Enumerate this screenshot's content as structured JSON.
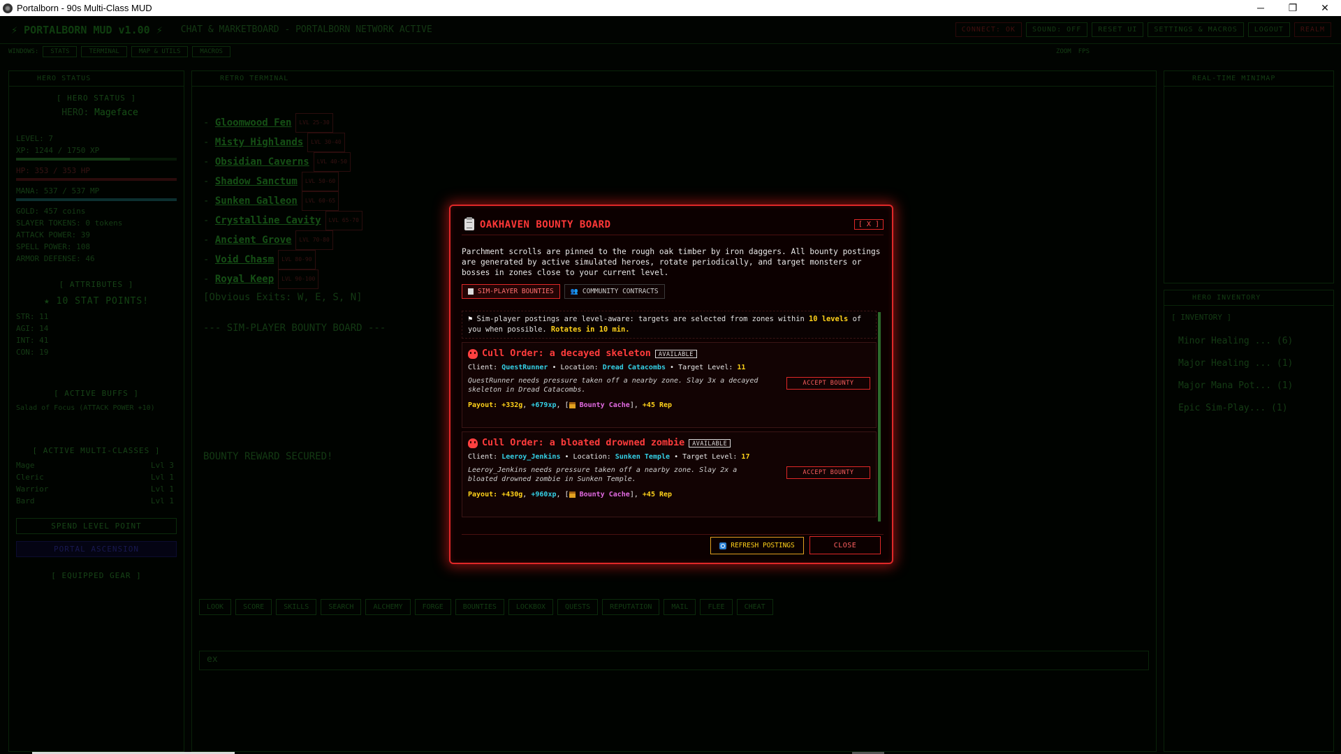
{
  "window": {
    "title": "Portalborn - 90s Multi-Class MUD",
    "minimize": "─",
    "restore": "❐",
    "close": "✕"
  },
  "app": {
    "title": "⚡ PORTALBORN MUD v1.00 ⚡",
    "chat_title": "CHAT & MARKETBOARD - PORTALBORN NETWORK ACTIVE",
    "top_buttons": [
      "CONNECT: OK",
      "SOUND: OFF",
      "RESET UI",
      "SETTINGS & MACROS",
      "LOGOUT",
      "REALM"
    ],
    "windows_label": "WINDOWS:",
    "window_buttons": [
      "STATS",
      "TERMINAL",
      "MAP & UTILS",
      "MACROS"
    ],
    "zoom_label": "ZOOM",
    "fps_label": "FPS"
  },
  "left_panel": {
    "head": "HERO STATUS",
    "hero_status_title": "[ HERO STATUS ]",
    "hero_label": "HERO:",
    "hero_name": "Mageface",
    "level": "LEVEL: 7",
    "xp": "XP: 1244 / 1750 XP",
    "xp_fraction": 0.71,
    "hp": "HP: 353 / 353 HP",
    "hp_fraction": 1.0,
    "mana": "MANA: 537 / 537 MP",
    "mana_fraction": 1.0,
    "gold": "GOLD: 457 coins",
    "slayer": "SLAYER TOKENS: 0 tokens",
    "attack": "ATTACK POWER: 39",
    "spell": "SPELL POWER: 108",
    "armor": "ARMOR DEFENSE: 46",
    "attributes_title": "[ ATTRIBUTES ]",
    "stat_points": "★ 10 STAT POINTS!",
    "attributes": [
      "STR: 11",
      "AGI: 14",
      "INT: 41",
      "CON: 19"
    ],
    "active_buffs_title": "[ ACTIVE BUFFS ]",
    "buff": "Salad of Focus (ATTACK POWER +10)",
    "multi_classes_title": "[ ACTIVE MULTI-CLASSES ]",
    "classes": [
      {
        "name": "Mage",
        "lvl": "Lvl 3"
      },
      {
        "name": "Cleric",
        "lvl": "Lvl 1"
      },
      {
        "name": "Warrior",
        "lvl": "Lvl 1"
      },
      {
        "name": "Bard",
        "lvl": "Lvl 1"
      }
    ],
    "spend_level": "SPEND LEVEL POINT",
    "portal_ascension": "PORTAL ASCENSION",
    "equipped_title": "[ EQUIPPED GEAR ]"
  },
  "terminal": {
    "head": "RETRO TERMINAL",
    "zones": [
      {
        "name": "Gloomwood Fen",
        "lvl": "LVL 25-30"
      },
      {
        "name": "Misty Highlands",
        "lvl": "LVL 30-40"
      },
      {
        "name": "Obsidian Caverns",
        "lvl": "LVL 40-50"
      },
      {
        "name": "Shadow Sanctum",
        "lvl": "LVL 50-60"
      },
      {
        "name": "Sunken Galleon",
        "lvl": "LVL 60-65"
      },
      {
        "name": "Crystalline Cavity",
        "lvl": "LVL 65-70"
      },
      {
        "name": "Ancient Grove",
        "lvl": "LVL 70-80"
      },
      {
        "name": "Void Chasm",
        "lvl": "LVL 80-90"
      },
      {
        "name": "Royal Keep",
        "lvl": "LVL 90-100"
      }
    ],
    "exits": "[Obvious Exits: W, E, S, N]",
    "bounty_header": "--- SIM-PLAYER BOUNTY BOARD ---",
    "reward": "BOUNTY REWARD SECURED!",
    "command": "ex",
    "actions": [
      "LOOK",
      "SCORE",
      "SKILLS",
      "SEARCH",
      "ALCHEMY",
      "FORGE",
      "BOUNTIES",
      "LOCKBOX",
      "QUESTS",
      "REPUTATION",
      "MAIL",
      "FLEE",
      "CHEAT"
    ]
  },
  "right_panel": {
    "minimap_head": "REAL-TIME MINIMAP",
    "inventory_head": "HERO INVENTORY",
    "inventory_title": "[ INVENTORY ]",
    "items": [
      "Minor Healing ... (6)",
      "Major Healing ... (1)",
      "Major Mana Pot... (1)",
      "Epic Sim-Play... (1)"
    ]
  },
  "modal": {
    "title": "OAKHAVEN BOUNTY BOARD",
    "close_x": "[ X ]",
    "description": "Parchment scrolls are pinned to the rough oak timber by iron daggers. All bounty postings are generated by active simulated heroes, rotate periodically, and target monsters or bosses in zones close to your current level.",
    "tabs": [
      {
        "label": "SIM-PLAYER BOUNTIES",
        "active": true
      },
      {
        "label": "COMMUNITY CONTRACTS",
        "active": false
      }
    ],
    "info": {
      "pre": "Sim-player postings are level-aware: targets are selected from zones within",
      "levels": "10 levels",
      "mid": "of you when possible.",
      "rotates": "Rotates in 10 min."
    },
    "bounties": [
      {
        "title": "Cull Order: a decayed skeleton",
        "status": "AVAILABLE",
        "client": "QuestRunner",
        "location": "Dread Catacombs",
        "target_level": "11",
        "flavor": "QuestRunner needs pressure taken off a nearby zone. Slay 3x a decayed skeleton in Dread Catacombs.",
        "gold": "+332g",
        "xp": "+679xp",
        "cache": "Bounty Cache",
        "rep": "+45 Rep",
        "accept": "ACCEPT BOUNTY"
      },
      {
        "title": "Cull Order: a bloated drowned zombie",
        "status": "AVAILABLE",
        "client": "Leeroy_Jenkins",
        "location": "Sunken Temple",
        "target_level": "17",
        "flavor": "Leeroy_Jenkins needs pressure taken off a nearby zone. Slay 2x a bloated drowned zombie in Sunken Temple.",
        "gold": "+430g",
        "xp": "+960xp",
        "cache": "Bounty Cache",
        "rep": "+45 Rep",
        "accept": "ACCEPT BOUNTY"
      }
    ],
    "labels": {
      "client": "Client:",
      "location": "Location:",
      "target_level": "Target Level:",
      "payout": "Payout:"
    },
    "refresh": "REFRESH POSTINGS",
    "close": "CLOSE"
  }
}
